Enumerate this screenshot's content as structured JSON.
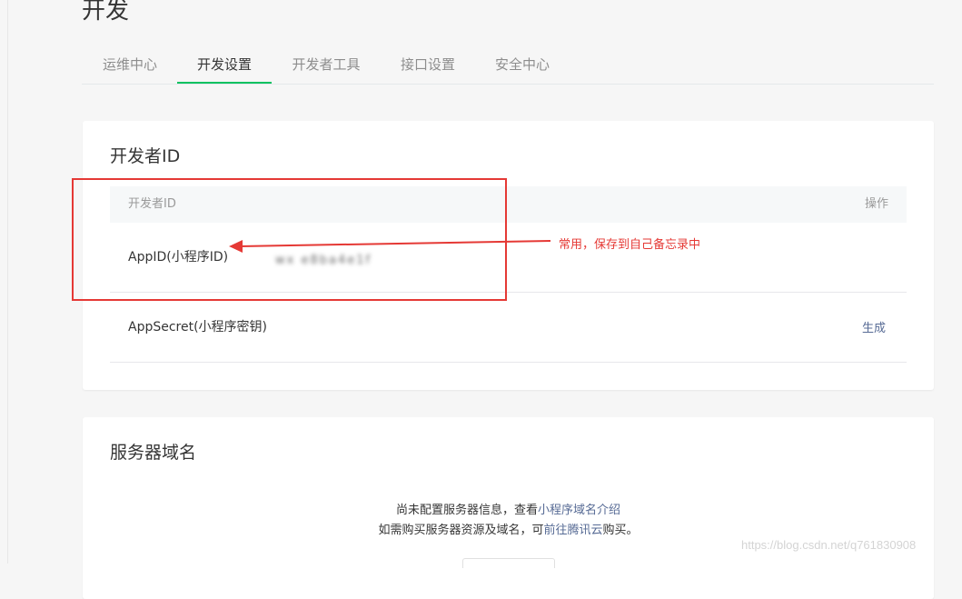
{
  "page": {
    "title": "开发"
  },
  "tabs": [
    {
      "label": "运维中心",
      "active": false
    },
    {
      "label": "开发设置",
      "active": true
    },
    {
      "label": "开发者工具",
      "active": false
    },
    {
      "label": "接口设置",
      "active": false
    },
    {
      "label": "安全中心",
      "active": false
    }
  ],
  "developer_id": {
    "title": "开发者ID",
    "columns": {
      "name": "开发者ID",
      "action": "操作"
    },
    "rows": [
      {
        "name": "AppID(小程序ID)",
        "value": "wx e8ba4e1f"
      },
      {
        "name": "AppSecret(小程序密钥)",
        "action": "生成"
      }
    ]
  },
  "annotation": {
    "text": "常用，保存到自己备忘录中",
    "color": "#e53935"
  },
  "server_domain": {
    "title": "服务器域名",
    "line1_prefix": "尚未配置服务器信息，查看",
    "line1_link": "小程序域名介绍",
    "line2_prefix": "如需购买服务器资源及域名，可",
    "line2_link": "前往腾讯云",
    "line2_suffix": "购买。"
  },
  "watermark": "https://blog.csdn.net/q761830908",
  "colors": {
    "accent": "#07c160",
    "link": "#576b95",
    "annotation": "#e53935"
  }
}
